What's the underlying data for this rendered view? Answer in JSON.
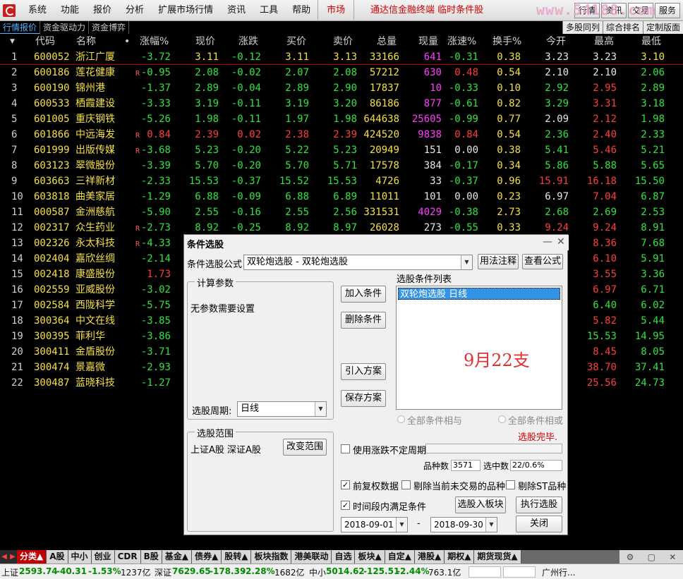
{
  "menubar": {
    "items": [
      "系统",
      "功能",
      "报价",
      "分析",
      "扩展市场行情",
      "资讯",
      "工具",
      "帮助"
    ],
    "market": "市场",
    "app_title": "通达信金融终端 临时条件股",
    "buttons": [
      "行情",
      "资讯",
      "交易",
      "服务"
    ],
    "watermark": "www.54188.com"
  },
  "subtabs": {
    "left": [
      "行情报价",
      "资金驱动力",
      "资金博弈"
    ],
    "right": [
      "多股同列",
      "综合排名",
      "定制版面"
    ]
  },
  "table": {
    "headers": [
      "代码",
      "名称",
      "•",
      "涨幅%",
      "现价",
      "涨跌",
      "买价",
      "卖价",
      "总量",
      "现量",
      "涨速%",
      "换手%",
      "今开",
      "最高",
      "最低"
    ],
    "sort_indicator": "▼",
    "rows": [
      {
        "idx": "1",
        "code": "600052",
        "name": "浙江广厦",
        "flag": "",
        "chg": "-3.72",
        "price": "3.11",
        "diff": "-0.12",
        "bid": "3.11",
        "ask": "3.13",
        "vol": "33166",
        "cur": "641",
        "speed": "-0.31",
        "turn": "0.38",
        "open": "3.23",
        "high": "3.23",
        "low": "3.10",
        "c_chg": "green",
        "c_price": "yellow",
        "c_diff": "green",
        "c_bid": "yellow",
        "c_ask": "yellow",
        "c_cur": "magenta",
        "c_speed": "green",
        "c_open": "white",
        "c_high": "white",
        "c_low": "yellow"
      },
      {
        "idx": "2",
        "code": "600186",
        "name": "莲花健康",
        "flag": "R",
        "chg": "-0.95",
        "price": "2.08",
        "diff": "-0.02",
        "bid": "2.07",
        "ask": "2.08",
        "vol": "57212",
        "cur": "630",
        "speed": "0.48",
        "turn": "0.54",
        "open": "2.10",
        "high": "2.10",
        "low": "2.06",
        "c_chg": "green",
        "c_price": "green",
        "c_diff": "green",
        "c_bid": "green",
        "c_ask": "green",
        "c_cur": "magenta",
        "c_speed": "red",
        "c_open": "white",
        "c_high": "white",
        "c_low": "green"
      },
      {
        "idx": "3",
        "code": "600190",
        "name": "锦州港",
        "flag": "",
        "chg": "-1.37",
        "price": "2.89",
        "diff": "-0.04",
        "bid": "2.89",
        "ask": "2.90",
        "vol": "17837",
        "cur": "10",
        "speed": "-0.33",
        "turn": "0.10",
        "open": "2.92",
        "high": "2.95",
        "low": "2.89",
        "c_chg": "green",
        "c_price": "green",
        "c_diff": "green",
        "c_bid": "green",
        "c_ask": "green",
        "c_cur": "magenta",
        "c_speed": "green",
        "c_open": "green",
        "c_high": "red",
        "c_low": "green"
      },
      {
        "idx": "4",
        "code": "600533",
        "name": "栖霞建设",
        "flag": "",
        "chg": "-3.33",
        "price": "3.19",
        "diff": "-0.11",
        "bid": "3.19",
        "ask": "3.20",
        "vol": "86186",
        "cur": "877",
        "speed": "-0.61",
        "turn": "0.82",
        "open": "3.29",
        "high": "3.31",
        "low": "3.18",
        "c_chg": "green",
        "c_price": "green",
        "c_diff": "green",
        "c_bid": "green",
        "c_ask": "green",
        "c_cur": "magenta",
        "c_speed": "green",
        "c_open": "green",
        "c_high": "red",
        "c_low": "green"
      },
      {
        "idx": "5",
        "code": "601005",
        "name": "重庆钢铁",
        "flag": "",
        "chg": "-5.26",
        "price": "1.98",
        "diff": "-0.11",
        "bid": "1.97",
        "ask": "1.98",
        "vol": "644638",
        "cur": "25605",
        "speed": "-0.99",
        "turn": "0.77",
        "open": "2.09",
        "high": "2.12",
        "low": "1.98",
        "c_chg": "green",
        "c_price": "green",
        "c_diff": "green",
        "c_bid": "green",
        "c_ask": "green",
        "c_cur": "magenta",
        "c_speed": "green",
        "c_open": "white",
        "c_high": "red",
        "c_low": "green"
      },
      {
        "idx": "6",
        "code": "601866",
        "name": "中远海发",
        "flag": "R",
        "chg": "0.84",
        "price": "2.39",
        "diff": "0.02",
        "bid": "2.38",
        "ask": "2.39",
        "vol": "424520",
        "cur": "9838",
        "speed": "0.84",
        "turn": "0.54",
        "open": "2.36",
        "high": "2.40",
        "low": "2.33",
        "c_chg": "red",
        "c_price": "red",
        "c_diff": "red",
        "c_bid": "red",
        "c_ask": "red",
        "c_cur": "magenta",
        "c_speed": "red",
        "c_open": "green",
        "c_high": "red",
        "c_low": "green"
      },
      {
        "idx": "7",
        "code": "601999",
        "name": "出版传媒",
        "flag": "R",
        "chg": "-3.68",
        "price": "5.23",
        "diff": "-0.20",
        "bid": "5.22",
        "ask": "5.23",
        "vol": "20949",
        "cur": "151",
        "speed": "0.00",
        "turn": "0.38",
        "open": "5.41",
        "high": "5.46",
        "low": "5.21",
        "c_chg": "green",
        "c_price": "green",
        "c_diff": "green",
        "c_bid": "green",
        "c_ask": "green",
        "c_cur": "white",
        "c_speed": "white",
        "c_open": "green",
        "c_high": "red",
        "c_low": "green"
      },
      {
        "idx": "8",
        "code": "603123",
        "name": "翠微股份",
        "flag": "",
        "chg": "-3.39",
        "price": "5.70",
        "diff": "-0.20",
        "bid": "5.70",
        "ask": "5.71",
        "vol": "17578",
        "cur": "384",
        "speed": "-0.17",
        "turn": "0.34",
        "open": "5.86",
        "high": "5.88",
        "low": "5.65",
        "c_chg": "green",
        "c_price": "green",
        "c_diff": "green",
        "c_bid": "green",
        "c_ask": "green",
        "c_cur": "white",
        "c_speed": "green",
        "c_open": "green",
        "c_high": "green",
        "c_low": "green"
      },
      {
        "idx": "9",
        "code": "603663",
        "name": "三祥新材",
        "flag": "",
        "chg": "-2.33",
        "price": "15.53",
        "diff": "-0.37",
        "bid": "15.52",
        "ask": "15.53",
        "vol": "4726",
        "cur": "33",
        "speed": "-0.37",
        "turn": "0.96",
        "open": "15.91",
        "high": "16.18",
        "low": "15.50",
        "c_chg": "green",
        "c_price": "green",
        "c_diff": "green",
        "c_bid": "green",
        "c_ask": "green",
        "c_cur": "white",
        "c_speed": "green",
        "c_open": "red",
        "c_high": "red",
        "c_low": "green"
      },
      {
        "idx": "10",
        "code": "603818",
        "name": "曲美家居",
        "flag": "",
        "chg": "-1.29",
        "price": "6.88",
        "diff": "-0.09",
        "bid": "6.88",
        "ask": "6.89",
        "vol": "11011",
        "cur": "101",
        "speed": "0.00",
        "turn": "0.23",
        "open": "6.97",
        "high": "7.04",
        "low": "6.87",
        "c_chg": "green",
        "c_price": "green",
        "c_diff": "green",
        "c_bid": "green",
        "c_ask": "green",
        "c_cur": "white",
        "c_speed": "white",
        "c_open": "white",
        "c_high": "red",
        "c_low": "green"
      },
      {
        "idx": "11",
        "code": "000587",
        "name": "金洲慈航",
        "flag": "",
        "chg": "-5.90",
        "price": "2.55",
        "diff": "-0.16",
        "bid": "2.55",
        "ask": "2.56",
        "vol": "331531",
        "cur": "4029",
        "speed": "-0.38",
        "turn": "2.73",
        "open": "2.68",
        "high": "2.69",
        "low": "2.53",
        "c_chg": "green",
        "c_price": "green",
        "c_diff": "green",
        "c_bid": "green",
        "c_ask": "green",
        "c_cur": "magenta",
        "c_speed": "green",
        "c_open": "green",
        "c_high": "green",
        "c_low": "green"
      },
      {
        "idx": "12",
        "code": "002317",
        "name": "众生药业",
        "flag": "R",
        "chg": "-2.73",
        "price": "8.92",
        "diff": "-0.25",
        "bid": "8.92",
        "ask": "8.97",
        "vol": "26028",
        "cur": "273",
        "speed": "-0.55",
        "turn": "0.33",
        "open": "9.24",
        "high": "9.24",
        "low": "8.91",
        "c_chg": "green",
        "c_price": "green",
        "c_diff": "green",
        "c_bid": "green",
        "c_ask": "green",
        "c_cur": "white",
        "c_speed": "green",
        "c_open": "red",
        "c_high": "red",
        "c_low": "green"
      },
      {
        "idx": "13",
        "code": "002326",
        "name": "永太科技",
        "flag": "R",
        "chg": "-4.33",
        "price": "",
        "diff": "",
        "bid": "",
        "ask": "",
        "vol": "",
        "cur": "",
        "speed": "",
        "turn": "",
        "open": "",
        "high": "8.36",
        "low": "7.68",
        "c_chg": "green",
        "c_high": "red",
        "c_low": "green"
      },
      {
        "idx": "14",
        "code": "002404",
        "name": "嘉欣丝绸",
        "flag": "",
        "chg": "-2.14",
        "price": "",
        "diff": "",
        "bid": "",
        "ask": "",
        "vol": "",
        "cur": "",
        "speed": "",
        "turn": "",
        "open": "",
        "high": "6.10",
        "low": "5.91",
        "c_chg": "green",
        "c_high": "red",
        "c_low": "green"
      },
      {
        "idx": "15",
        "code": "002418",
        "name": "康盛股份",
        "flag": "",
        "chg": "1.73",
        "price": "",
        "diff": "",
        "bid": "",
        "ask": "",
        "vol": "",
        "cur": "",
        "speed": "",
        "turn": "",
        "open": "",
        "high": "3.55",
        "low": "3.36",
        "c_chg": "red",
        "c_high": "red",
        "c_low": "green"
      },
      {
        "idx": "16",
        "code": "002559",
        "name": "亚威股份",
        "flag": "",
        "chg": "-3.02",
        "price": "",
        "diff": "",
        "bid": "",
        "ask": "",
        "vol": "",
        "cur": "",
        "speed": "",
        "turn": "",
        "open": "",
        "high": "6.97",
        "low": "6.71",
        "c_chg": "green",
        "c_high": "red",
        "c_low": "green"
      },
      {
        "idx": "17",
        "code": "002584",
        "name": "西陇科学",
        "flag": "",
        "chg": "-5.75",
        "price": "",
        "diff": "",
        "bid": "",
        "ask": "",
        "vol": "",
        "cur": "",
        "speed": "",
        "turn": "",
        "open": "",
        "high": "6.40",
        "low": "6.02",
        "c_chg": "green",
        "c_high": "green",
        "c_low": "green"
      },
      {
        "idx": "18",
        "code": "300364",
        "name": "中文在线",
        "flag": "",
        "chg": "-3.85",
        "price": "",
        "diff": "",
        "bid": "",
        "ask": "",
        "vol": "",
        "cur": "",
        "speed": "",
        "turn": "",
        "open": "",
        "high": "5.82",
        "low": "5.44",
        "c_chg": "green",
        "c_high": "red",
        "c_low": "green"
      },
      {
        "idx": "19",
        "code": "300395",
        "name": "菲利华",
        "flag": "",
        "chg": "-3.86",
        "price": "",
        "diff": "",
        "bid": "",
        "ask": "",
        "vol": "",
        "cur": "",
        "speed": "",
        "turn": "",
        "open": "",
        "high": "15.53",
        "low": "14.95",
        "c_chg": "green",
        "c_high": "green",
        "c_low": "green"
      },
      {
        "idx": "20",
        "code": "300411",
        "name": "金盾股份",
        "flag": "",
        "chg": "-3.71",
        "price": "",
        "diff": "",
        "bid": "",
        "ask": "",
        "vol": "",
        "cur": "",
        "speed": "",
        "turn": "",
        "open": "",
        "high": "8.45",
        "low": "8.05",
        "c_chg": "green",
        "c_high": "red",
        "c_low": "green"
      },
      {
        "idx": "21",
        "code": "300474",
        "name": "景嘉微",
        "flag": "",
        "chg": "-2.93",
        "price": "",
        "diff": "",
        "bid": "",
        "ask": "",
        "vol": "",
        "cur": "",
        "speed": "",
        "turn": "",
        "open": "",
        "high": "38.70",
        "low": "37.41",
        "c_chg": "green",
        "c_high": "red",
        "c_low": "green"
      },
      {
        "idx": "22",
        "code": "300487",
        "name": "蓝晓科技",
        "flag": "",
        "chg": "-1.27",
        "price": "",
        "diff": "",
        "bid": "",
        "ask": "",
        "vol": "",
        "cur": "",
        "speed": "",
        "turn": "",
        "open": "",
        "high": "25.56",
        "low": "24.73",
        "c_chg": "green",
        "c_high": "red",
        "c_low": "green"
      }
    ]
  },
  "dialog": {
    "title": "条件选股",
    "formula_label": "条件选股公式",
    "formula_value": "双轮炮选股  - 双轮炮选股",
    "usage_button": "用法注释",
    "view_formula_button": "查看公式",
    "params_group": "计算参数",
    "params_text": "无参数需要设置",
    "period_label": "选股周期:",
    "period_value": "日线",
    "add_button": "加入条件",
    "delete_button": "删除条件",
    "import_button": "引入方案",
    "save_button": "保存方案",
    "list_label": "选股条件列表",
    "list_item": "双轮炮选股  日线",
    "annotation": "9月22支",
    "radio_and": "全部条件相与",
    "radio_or": "全部条件相或",
    "done_text": "选股完毕.",
    "scope_group": "选股范围",
    "scope_text": "上证A股 深证A股",
    "change_scope_button": "改变范围",
    "uncertain_period_label": "使用涨跌不定周期",
    "count_label": "品种数",
    "count_value": "3571",
    "selected_label": "选中数",
    "selected_value": "22/0.6%",
    "prior_rights_label": "前复权数据",
    "exclude_untraded_label": "剔除当前未交易的品种",
    "exclude_st_label": "剔除ST品种",
    "time_range_label": "时间段内满足条件",
    "to_block_button": "选股入板块",
    "execute_button": "执行选股",
    "start_date": "2018-09-01",
    "date_sep": "-",
    "end_date": "2018-09-30",
    "close_button": "关闭"
  },
  "bottom_tabs": [
    "分类▲",
    "A股",
    "中小",
    "创业",
    "CDR",
    "B股",
    "基金▲",
    "债券▲",
    "股转▲",
    "板块指数",
    "港美联动",
    "自选",
    "板块▲",
    "自定▲",
    "港股▲",
    "期权▲",
    "期货现货▲"
  ],
  "statusbar": {
    "sh_label": "上证",
    "sh_value": "2593.74",
    "sh_diff": "-40.31",
    "sh_pct": "-1.53%",
    "sh_amount": "1237亿",
    "sz_label": "深证",
    "sz_value": "7629.65",
    "sz_diff": "-178.39",
    "sz_pct": "-2.28%",
    "sz_amount": "1682亿",
    "zx_label": "中小",
    "zx_value": "5014.62",
    "zx_diff": "-125.51",
    "zx_pct": "-2.44%",
    "zx_amount": "763.1亿",
    "location": "广州行..."
  },
  "colors": {
    "green": "#2ee53c",
    "red": "#ff3c3c",
    "yellow": "#f4e040",
    "magenta": "#ff3cff",
    "accent": "#c00000"
  }
}
